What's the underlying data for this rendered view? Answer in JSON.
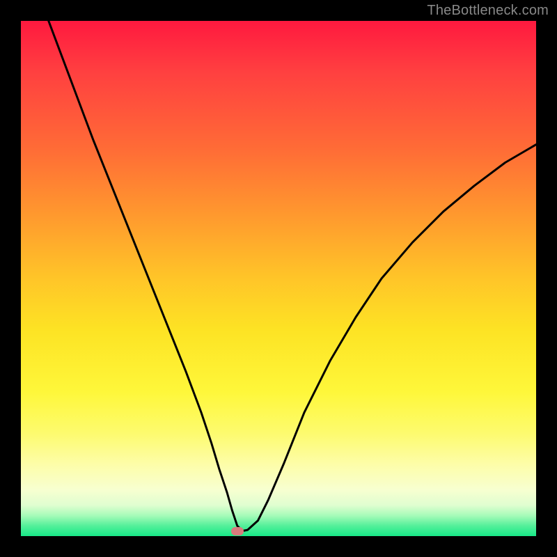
{
  "watermark": "TheBottleneck.com",
  "colors": {
    "curve_stroke": "#000000",
    "marker_fill": "#d87b7d",
    "frame_bg": "#000000"
  },
  "chart_data": {
    "type": "line",
    "title": "",
    "xlabel": "",
    "ylabel": "",
    "xlim": [
      0,
      100
    ],
    "ylim": [
      0,
      100
    ],
    "grid": false,
    "legend": false,
    "marker": {
      "x": 42,
      "y": 1
    },
    "series": [
      {
        "name": "bottleneck-curve",
        "x": [
          0,
          2,
          5,
          8,
          11,
          14,
          17,
          20,
          23,
          26,
          29,
          32,
          35,
          37,
          38.5,
          40,
          41,
          42,
          43,
          44,
          46,
          48,
          51,
          55,
          60,
          65,
          70,
          76,
          82,
          88,
          94,
          100
        ],
        "y": [
          115,
          109,
          101,
          93,
          85,
          77,
          69.5,
          62,
          54.5,
          47,
          39.5,
          32,
          24,
          18,
          13,
          8.5,
          5,
          2,
          1,
          1.2,
          3,
          7,
          14,
          24,
          34,
          42.5,
          50,
          57,
          63,
          68,
          72.5,
          76
        ]
      }
    ]
  }
}
